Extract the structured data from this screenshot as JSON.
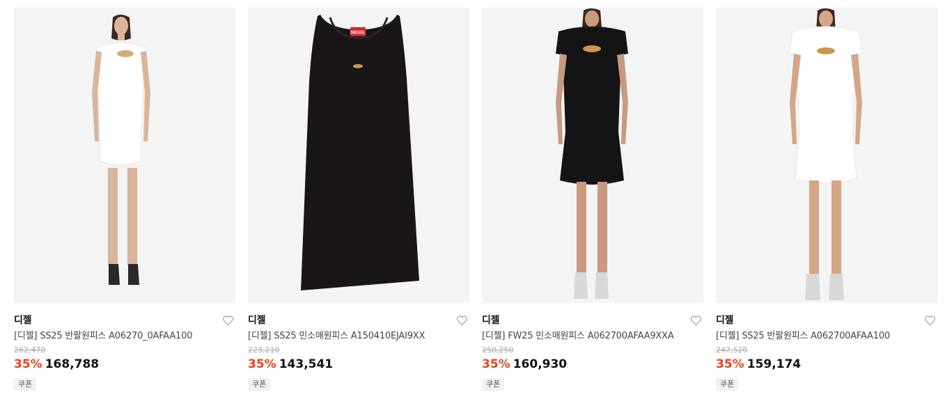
{
  "products": [
    {
      "brand": "디젤",
      "title": "[디젤] SS25 반팔원피스 A06270_0AFAA100",
      "original_price": "262,470",
      "discount": "35%",
      "price": "168,788",
      "badge": "쿠폰",
      "image": "white-cutout-dress-photo",
      "dress_color": "#ffffff"
    },
    {
      "brand": "디젤",
      "title": "[디젤] SS25 민소매원피스 A150410EJAI9XX",
      "original_price": "223,210",
      "discount": "35%",
      "price": "143,541",
      "badge": "쿠폰",
      "image": "black-tank-dress-photo",
      "dress_color": "#1a1616",
      "logo_text": "DIESEL"
    },
    {
      "brand": "디젤",
      "title": "[디젤] FW25 민소매원피스 A062700AFAA9XXA",
      "original_price": "250,250",
      "discount": "35%",
      "price": "160,930",
      "badge": "쿠폰",
      "image": "black-cutout-dress-photo",
      "dress_color": "#141417"
    },
    {
      "brand": "디젤",
      "title": "[디젤] SS25 반팔원피스 A062700AFAA100",
      "original_price": "247,520",
      "discount": "35%",
      "price": "159,174",
      "badge": "쿠폰",
      "image": "white-cutout-dress-photo-2",
      "dress_color": "#ffffff"
    }
  ],
  "colors": {
    "discount": "#e8421d",
    "image_bg": "#f4f4f4"
  },
  "icons": {
    "wishlist": "heart-outline-icon"
  }
}
